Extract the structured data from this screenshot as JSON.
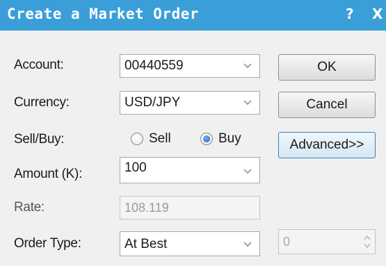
{
  "window": {
    "title": "Create a Market Order",
    "help_label": "?",
    "close_label": "X",
    "titlebar_color": "#3a9fd8"
  },
  "form": {
    "account": {
      "label": "Account:",
      "value": "00440559"
    },
    "currency": {
      "label": "Currency:",
      "value": "USD/JPY"
    },
    "side": {
      "label": "Sell/Buy:",
      "options": [
        "Sell",
        "Buy"
      ],
      "selected": "Buy"
    },
    "amount": {
      "label": "Amount (K):",
      "value": "100"
    },
    "rate": {
      "label": "Rate:",
      "value": "108.119"
    },
    "order_type": {
      "label": "Order Type:",
      "value": "At Best",
      "spinner_value": "0"
    }
  },
  "buttons": {
    "ok": "OK",
    "cancel": "Cancel",
    "advanced": "Advanced>>"
  },
  "icons": {
    "dropdown": "chevron-down-icon",
    "spinner": "spinner-arrows-icon"
  }
}
